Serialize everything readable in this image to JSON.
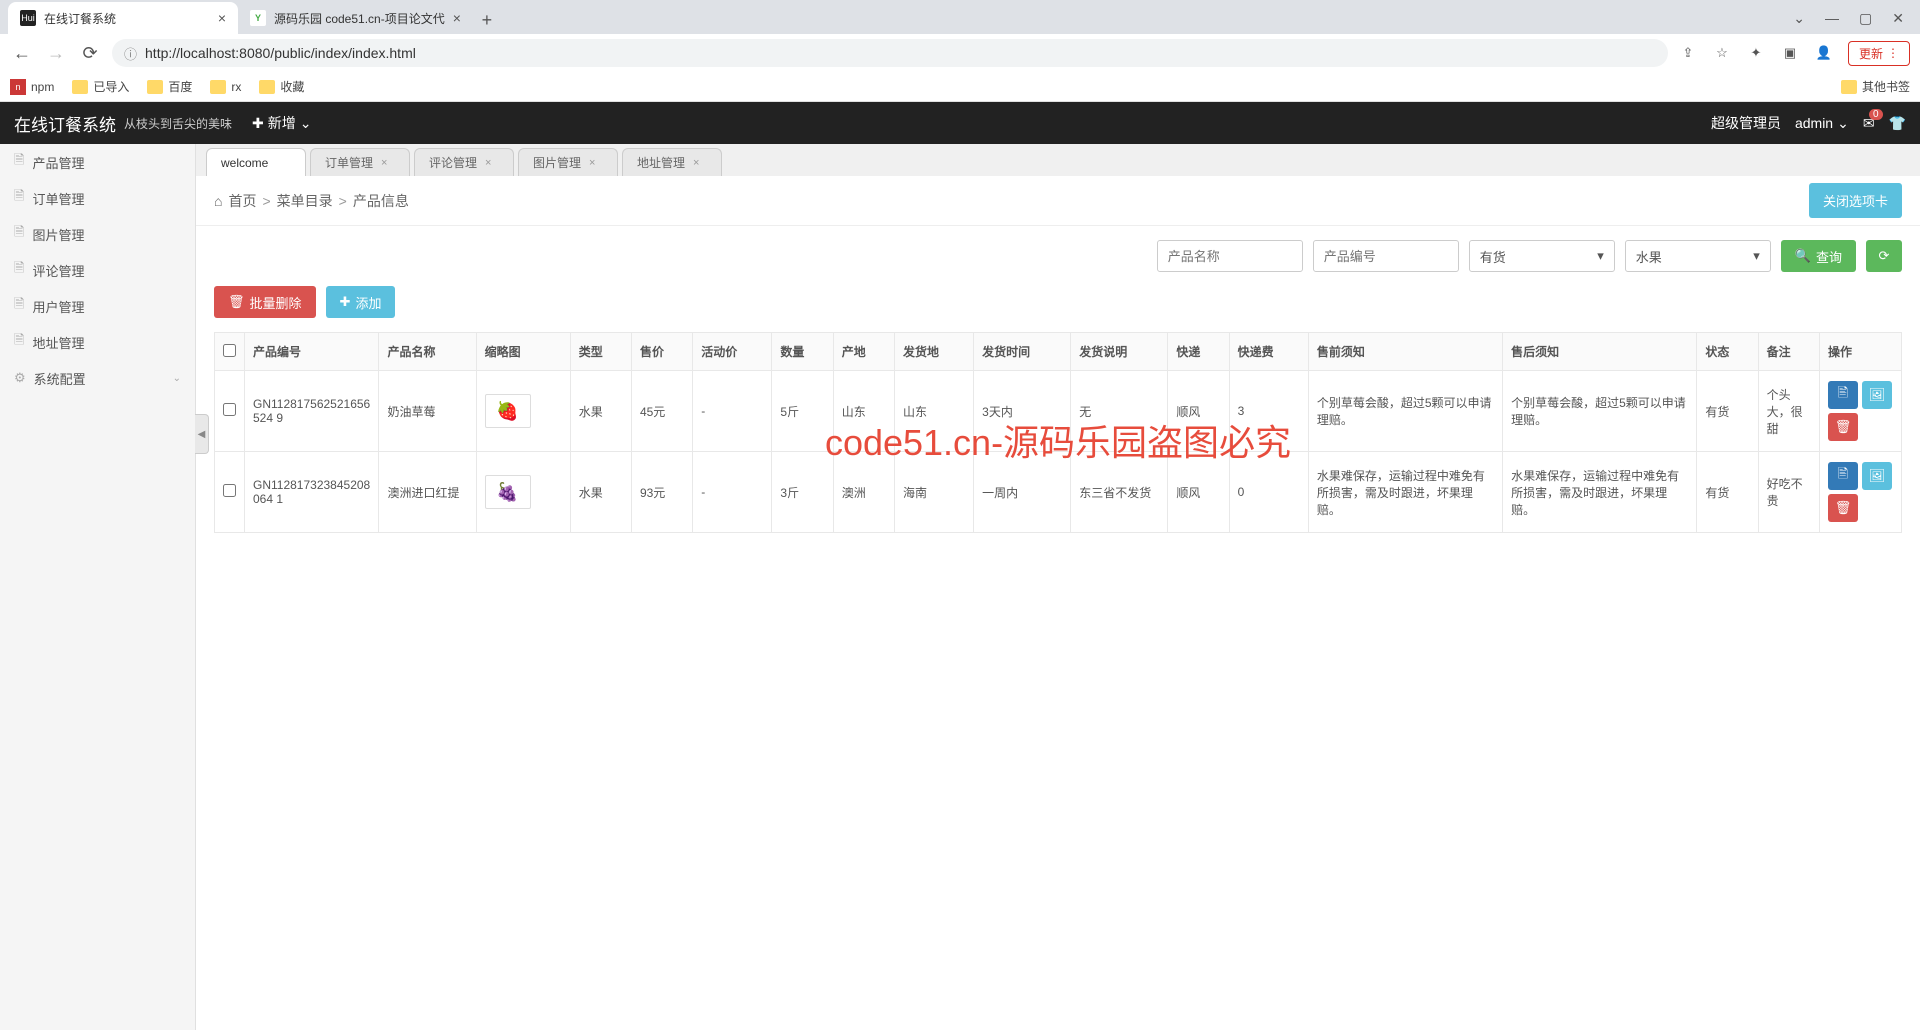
{
  "browser": {
    "tabs": [
      {
        "title": "在线订餐系统",
        "favicon": "Hui",
        "active": true
      },
      {
        "title": "源码乐园 code51.cn-项目论文代",
        "favicon": "Y",
        "active": false
      }
    ],
    "url": "http://localhost:8080/public/index/index.html",
    "update": "更新",
    "bookmarks": [
      "npm",
      "已导入",
      "百度",
      "rx",
      "收藏"
    ],
    "other_bm": "其他书签"
  },
  "header": {
    "title": "在线订餐系统",
    "subtitle": "从枝头到舌尖的美味",
    "add": "新增",
    "role": "超级管理员",
    "user": "admin",
    "mail_count": "0"
  },
  "sidebar": {
    "items": [
      "产品管理",
      "订单管理",
      "图片管理",
      "评论管理",
      "用户管理",
      "地址管理",
      "系统配置"
    ]
  },
  "page_tabs": [
    {
      "label": "welcome",
      "closable": false,
      "active": true
    },
    {
      "label": "订单管理",
      "closable": true
    },
    {
      "label": "评论管理",
      "closable": true
    },
    {
      "label": "图片管理",
      "closable": true
    },
    {
      "label": "地址管理",
      "closable": true
    }
  ],
  "breadcrumb": {
    "home": "首页",
    "items": [
      "菜单目录",
      "产品信息"
    ]
  },
  "close_tab": "关闭选项卡",
  "filters": {
    "name_ph": "产品名称",
    "code_ph": "产品编号",
    "stock": "有货",
    "category": "水果",
    "query": "查询"
  },
  "actions": {
    "batch_delete": "批量删除",
    "add": "添加"
  },
  "table": {
    "headers": [
      "产品编号",
      "产品名称",
      "缩略图",
      "类型",
      "售价",
      "活动价",
      "数量",
      "产地",
      "发货地",
      "发货时间",
      "发货说明",
      "快递",
      "快递费",
      "售前须知",
      "售后须知",
      "状态",
      "备注",
      "操作"
    ],
    "rows": [
      {
        "code": "GN112817562521656524\n9",
        "name": "奶油草莓",
        "thumb": "🍓",
        "type": "水果",
        "price": "45元",
        "act_price": "-",
        "qty": "5斤",
        "origin": "山东",
        "ship_from": "山东",
        "ship_time": "3天内",
        "ship_note": "无",
        "express": "顺风",
        "express_fee": "3",
        "presale": "个别草莓会酸，超过5颗可以申请理赔。",
        "aftersale": "个别草莓会酸，超过5颗可以申请理赔。",
        "status": "有货",
        "remark": "个头大，很甜"
      },
      {
        "code": "GN112817323845208064\n1",
        "name": "澳洲进口红提",
        "thumb": "🍇",
        "type": "水果",
        "price": "93元",
        "act_price": "-",
        "qty": "3斤",
        "origin": "澳洲",
        "ship_from": "海南",
        "ship_time": "一周内",
        "ship_note": "东三省不发货",
        "express": "顺风",
        "express_fee": "0",
        "presale": "水果难保存，运输过程中难免有所损害，需及时跟进，坏果理赔。",
        "aftersale": "水果难保存，运输过程中难免有所损害，需及时跟进，坏果理赔。",
        "status": "有货",
        "remark": "好吃不贵"
      }
    ]
  },
  "watermark": "code51.cn-源码乐园盗图必究"
}
